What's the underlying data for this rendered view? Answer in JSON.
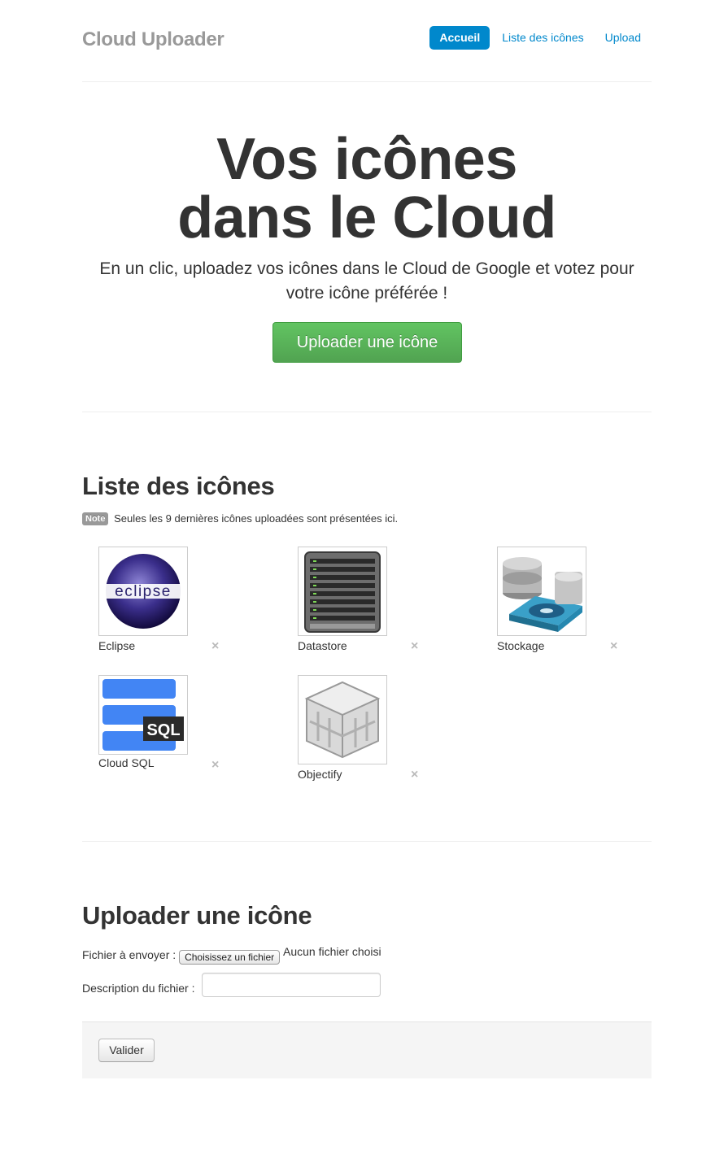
{
  "header": {
    "brand": "Cloud Uploader",
    "nav": [
      {
        "label": "Accueil",
        "active": true
      },
      {
        "label": "Liste des icônes",
        "active": false
      },
      {
        "label": "Upload",
        "active": false
      }
    ]
  },
  "hero": {
    "title_line1": "Vos icônes",
    "title_line2": "dans le Cloud",
    "lead": "En un clic, uploadez vos icônes dans le Cloud de Google et votez pour votre icône préférée !",
    "cta": "Uploader une icône"
  },
  "icons_section": {
    "title": "Liste des icônes",
    "note_label": "Note",
    "note_text": "Seules les 9 dernières icônes uploadées sont présentées ici.",
    "remove_symbol": "×",
    "icons": [
      {
        "label": "Eclipse",
        "icon": "eclipse-icon"
      },
      {
        "label": "Datastore",
        "icon": "server-rack-icon"
      },
      {
        "label": "Stockage",
        "icon": "storage-disk-icon"
      },
      {
        "label": "Cloud SQL",
        "icon": "cloud-sql-icon"
      },
      {
        "label": "Objectify",
        "icon": "cube-icon"
      }
    ]
  },
  "upload_section": {
    "title": "Uploader une icône",
    "file_label": "Fichier à envoyer :",
    "file_button": "Choisissez un fichier",
    "file_status": "Aucun fichier choisi",
    "description_label": "Description du fichier :",
    "description_value": "",
    "submit": "Valider"
  },
  "colors": {
    "accent": "#0088cc",
    "success": "#5bb75b",
    "brand_gray": "#999999"
  }
}
